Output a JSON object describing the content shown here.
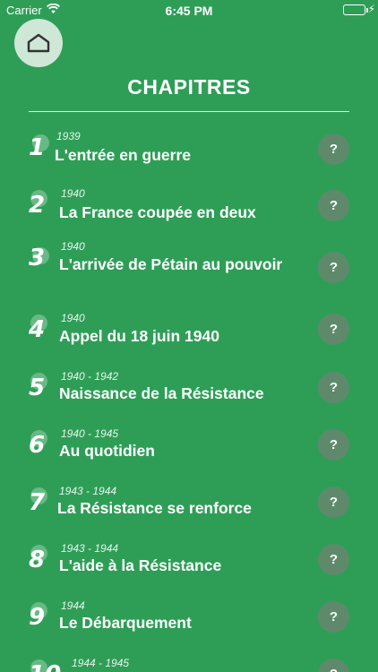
{
  "status_bar": {
    "carrier": "Carrier",
    "time": "6:45 PM"
  },
  "header": {
    "title": "CHAPITRES"
  },
  "chapters": [
    {
      "number": "1",
      "year": "1939",
      "title": "L'entrée en guerre",
      "help": "?"
    },
    {
      "number": "2",
      "year": "1940",
      "title": "La France coupée en deux",
      "help": "?"
    },
    {
      "number": "3",
      "year": "1940",
      "title": "L'arrivée de Pétain au pouvoir",
      "help": "?"
    },
    {
      "number": "4",
      "year": "1940",
      "title": "Appel du 18 juin 1940",
      "help": "?"
    },
    {
      "number": "5",
      "year": "1940 - 1942",
      "title": "Naissance de la Résistance",
      "help": "?"
    },
    {
      "number": "6",
      "year": "1940 - 1945",
      "title": "Au quotidien",
      "help": "?"
    },
    {
      "number": "7",
      "year": "1943 - 1944",
      "title": "La Résistance se renforce",
      "help": "?"
    },
    {
      "number": "8",
      "year": "1943 - 1944",
      "title": "L'aide à la Résistance",
      "help": "?"
    },
    {
      "number": "9",
      "year": "1944",
      "title": "Le Débarquement",
      "help": "?"
    },
    {
      "number": "10",
      "year": "1944 - 1945",
      "title": "",
      "help": "?"
    }
  ],
  "colors": {
    "background": "#2e9e57",
    "help_button": "#5e8a6b",
    "home_button": "#cfe7d6"
  },
  "icons": {
    "home": "home-icon",
    "wifi": "wifi-icon",
    "battery": "battery-icon"
  }
}
